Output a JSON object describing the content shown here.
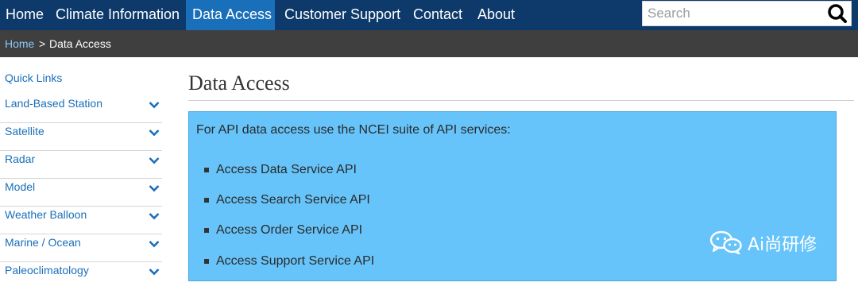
{
  "nav": {
    "items": [
      {
        "label": "Home"
      },
      {
        "label": "Climate Information"
      },
      {
        "label": "Data Access",
        "active": true
      },
      {
        "label": "Customer Support"
      },
      {
        "label": "Contact"
      },
      {
        "label": "About"
      }
    ],
    "search": {
      "placeholder": "Search",
      "value": "",
      "icon": "search-icon"
    }
  },
  "breadcrumb": {
    "home": "Home",
    "separator": ">",
    "current": "Data Access"
  },
  "sidebar": {
    "heading": "Quick Links",
    "items": [
      {
        "label": "Land-Based Station",
        "icon": "chevron-down-icon"
      },
      {
        "label": "Satellite",
        "icon": "chevron-down-icon"
      },
      {
        "label": "Radar",
        "icon": "chevron-down-icon"
      },
      {
        "label": "Model",
        "icon": "chevron-down-icon"
      },
      {
        "label": "Weather Balloon",
        "icon": "chevron-down-icon"
      },
      {
        "label": "Marine / Ocean",
        "icon": "chevron-down-icon"
      },
      {
        "label": "Paleoclimatology",
        "icon": "chevron-down-icon"
      }
    ]
  },
  "main": {
    "title": "Data Access",
    "intro": "For API data access use the NCEI suite of API services:",
    "api_items": [
      {
        "label": "Access Data Service API"
      },
      {
        "label": "Access Search Service API"
      },
      {
        "label": "Access Order Service API"
      },
      {
        "label": "Access Support Service API"
      }
    ]
  },
  "watermark": {
    "text": "Ai尚研修",
    "icon": "wechat-icon"
  },
  "colors": {
    "nav_bg": "#0e3a6b",
    "nav_active": "#1a6fba",
    "breadcrumb_bg": "#3f3f3f",
    "link": "#1a6fba",
    "info_box": "#66c4fa"
  }
}
